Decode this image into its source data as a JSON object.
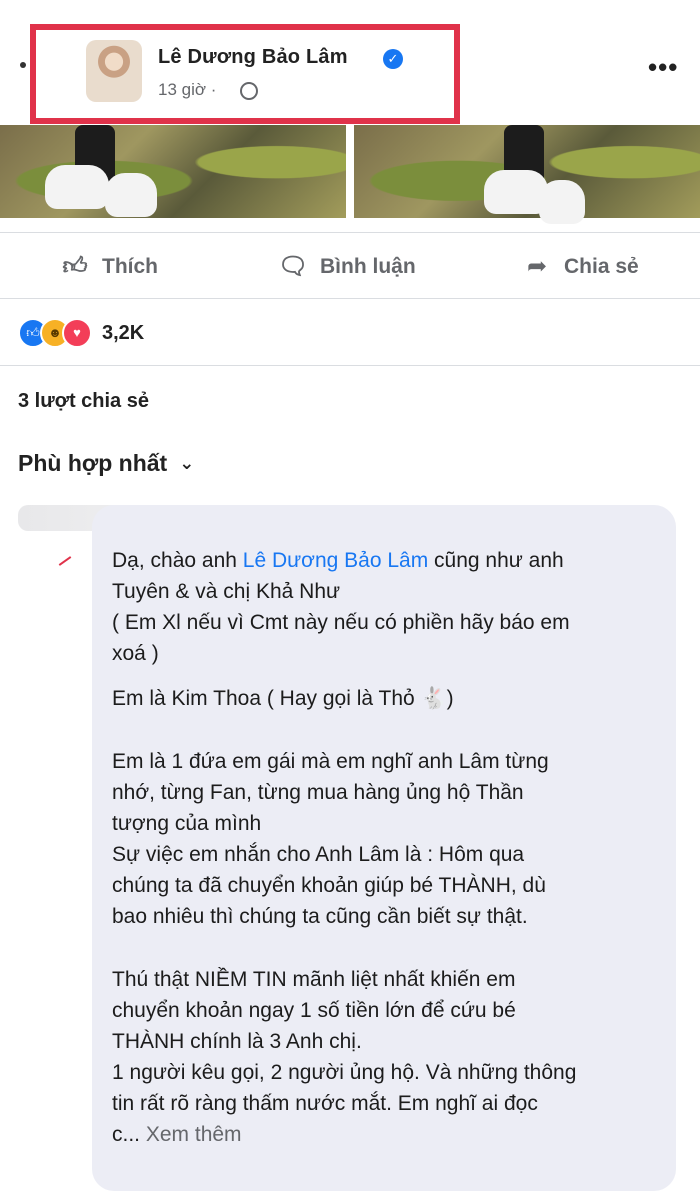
{
  "post": {
    "author": "Lê Dương Bảo Lâm",
    "time": "13 giờ ·",
    "more_icon": "more-horizontal-icon"
  },
  "actions": {
    "like": "Thích",
    "comment": "Bình luận",
    "share": "Chia sẻ"
  },
  "stats": {
    "reaction_count": "3,2K",
    "share_count": "3 lượt chia sẻ"
  },
  "comments": {
    "sort_label": "Phù hợp nhất",
    "first": {
      "line1_prefix": "Dạ, chào anh ",
      "line1_mention": "Lê Dương Bảo Lâm",
      "line1_suffix": " cũng như anh",
      "line2": "Tuyên & và chị Khả Như",
      "line3": "( Em Xl nếu vì Cmt này nếu có phiền hãy báo em",
      "line4": "xoá )",
      "line5": "Em là Kim Thoa ( Hay gọi là Thỏ 🐇)",
      "line6": "Em là 1 đứa em gái mà em nghĩ anh Lâm từng",
      "line7": "nhớ, từng Fan, từng mua hàng ủng hộ Thần",
      "line8": "tượng của mình",
      "line9": "Sự việc em nhắn cho Anh Lâm là : Hôm qua",
      "line10": "chúng ta đã chuyển khoản giúp bé THÀNH, dù",
      "line11": "bao nhiêu thì chúng ta cũng cần biết sự thật.",
      "line12": "Thú thật NIỀM TIN mãnh liệt nhất khiến em",
      "line13": "chuyển khoản ngay 1 số tiền lớn để cứu bé",
      "line14": "THÀNH chính là 3 Anh chị.",
      "line15": "1 người kêu gọi, 2 người ủng hộ. Và những thông",
      "line16": "tin rất rõ ràng thấm nước mắt. Em nghĩ ai đọc",
      "line17_prefix": "c... ",
      "see_more": "Xem thêm"
    }
  }
}
